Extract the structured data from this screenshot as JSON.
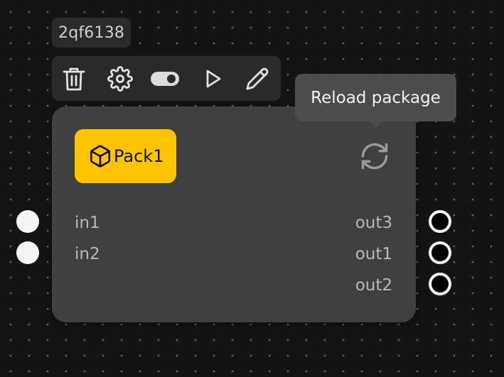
{
  "node": {
    "id": "2qf6138",
    "toolbar": [
      {
        "name": "trash-icon",
        "label": "Delete"
      },
      {
        "name": "gear-icon",
        "label": "Settings"
      },
      {
        "name": "toggle-icon",
        "label": "Toggle"
      },
      {
        "name": "play-icon",
        "label": "Run"
      },
      {
        "name": "pencil-icon",
        "label": "Edit"
      }
    ],
    "package": {
      "icon": "package-icon",
      "label": "Pack1",
      "color": "#ffc400"
    },
    "reload": {
      "icon": "reload-icon",
      "tooltip": "Reload package"
    },
    "inputs": [
      "in1",
      "in2"
    ],
    "outputs": [
      "out3",
      "out1",
      "out2"
    ]
  },
  "colors": {
    "canvas": "#141414",
    "node_body": "#404040",
    "toolbar": "#2a2a2a",
    "tooltip": "#4c4c4c"
  }
}
